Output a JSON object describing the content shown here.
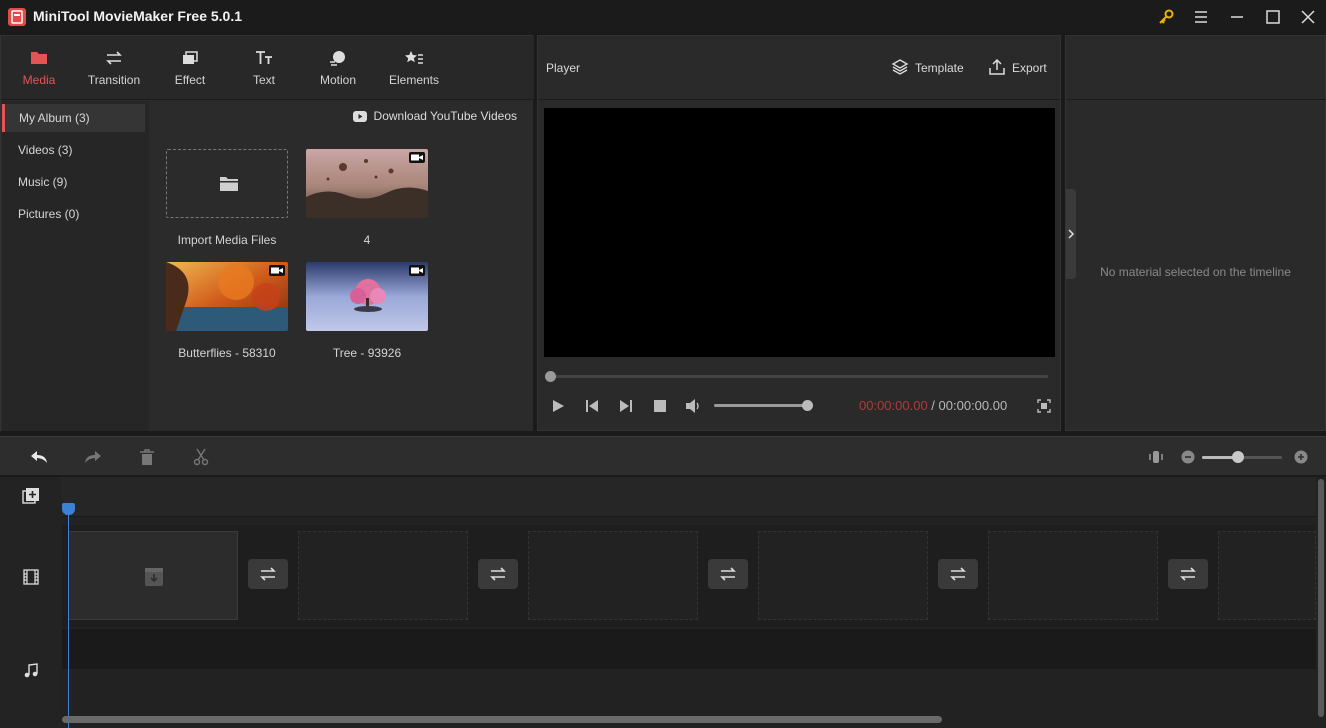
{
  "app": {
    "title": "MiniTool MovieMaker Free 5.0.1"
  },
  "tabs": [
    {
      "label": "Media",
      "icon": "folder-icon",
      "active": true
    },
    {
      "label": "Transition",
      "icon": "swap-arrows-icon"
    },
    {
      "label": "Effect",
      "icon": "layers-icon"
    },
    {
      "label": "Text",
      "icon": "text-icon"
    },
    {
      "label": "Motion",
      "icon": "motion-icon"
    },
    {
      "label": "Elements",
      "icon": "elements-icon"
    }
  ],
  "album": {
    "items": [
      {
        "label": "My Album (3)",
        "active": true
      },
      {
        "label": "Videos (3)"
      },
      {
        "label": "Music (9)"
      },
      {
        "label": "Pictures (0)"
      }
    ]
  },
  "media": {
    "download_label": "Download YouTube Videos",
    "import_label": "Import Media Files",
    "items": [
      {
        "label": "4"
      },
      {
        "label": "Butterflies - 58310"
      },
      {
        "label": "Tree - 93926"
      }
    ]
  },
  "player": {
    "title": "Player",
    "template_label": "Template",
    "export_label": "Export",
    "time_current": "00:00:00.00",
    "time_separator": " / ",
    "time_total": "00:00:00.00",
    "volume": 1.0
  },
  "properties": {
    "empty_message": "No material selected on the timeline"
  },
  "colors": {
    "accent": "#e55454",
    "playhead": "#3b82d6"
  }
}
